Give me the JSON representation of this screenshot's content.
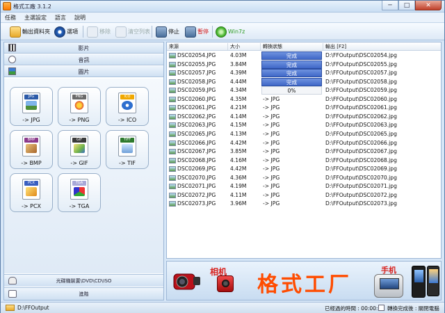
{
  "window": {
    "title": "格式工廠 3.1.2",
    "controls": {
      "minimize": "─",
      "maximize": "□",
      "close": "✕"
    }
  },
  "menu": [
    "任務",
    "主選設定",
    "語言",
    "說明"
  ],
  "toolbar": {
    "output_folder": "輸出資料夾",
    "options": "選項",
    "remove": "移除",
    "clear_list": "清空列表",
    "stop": "停止",
    "pause": "暫停",
    "win7z": "Win7z"
  },
  "left": {
    "categories": {
      "video": "影片",
      "audio": "音訊",
      "picture": "圖片"
    },
    "formats": [
      {
        "tag": "JPG",
        "label": "-> JPG",
        "tag_color": "#2b5aa8"
      },
      {
        "tag": "PNG",
        "label": "-> PNG",
        "tag_color": "#6a6a6a"
      },
      {
        "tag": "ICO",
        "label": "-> ICO",
        "tag_color": "#f0a800"
      },
      {
        "tag": "BMP",
        "label": "-> BMP",
        "tag_color": "#8b3a8b"
      },
      {
        "tag": "GIF",
        "label": "-> GIF",
        "tag_color": "#3a3a3a"
      },
      {
        "tag": "TIFF",
        "label": "-> TIF",
        "tag_color": "#2e7a2e"
      },
      {
        "tag": "PCX",
        "label": "-> PCX",
        "tag_color": "#3a5fc0"
      },
      {
        "tag": "TGA",
        "label": "-> TGA",
        "tag_color": "#a8a8d8"
      }
    ],
    "rom_device": "光碟機裝置\\DVD\\CD\\ISO",
    "advanced": "進階"
  },
  "list": {
    "headers": {
      "source": "來源",
      "size": "大小",
      "status": "轉換狀態",
      "output": "輸出 [F2]"
    },
    "rows": [
      {
        "source": "DSC02054.JPG",
        "size": "4.03M",
        "status": "完成",
        "state": "done",
        "output": "D:\\FFOutput\\DSC02054.jpg"
      },
      {
        "source": "DSC02055.JPG",
        "size": "3.84M",
        "status": "完成",
        "state": "done",
        "output": "D:\\FFOutput\\DSC02055.jpg"
      },
      {
        "source": "DSC02057.JPG",
        "size": "4.39M",
        "status": "完成",
        "state": "done",
        "output": "D:\\FFOutput\\DSC02057.jpg"
      },
      {
        "source": "DSC02058.JPG",
        "size": "4.44M",
        "status": "完成",
        "state": "done",
        "output": "D:\\FFOutput\\DSC02058.jpg"
      },
      {
        "source": "DSC02059.JPG",
        "size": "4.34M",
        "status": "0%",
        "state": "progress",
        "output": "D:\\FFOutput\\DSC02059.jpg"
      },
      {
        "source": "DSC02060.JPG",
        "size": "4.35M",
        "status": "-> JPG",
        "state": "queued",
        "output": "D:\\FFOutput\\DSC02060.jpg"
      },
      {
        "source": "DSC02061.JPG",
        "size": "4.21M",
        "status": "-> JPG",
        "state": "queued",
        "output": "D:\\FFOutput\\DSC02061.jpg"
      },
      {
        "source": "DSC02062.JPG",
        "size": "4.14M",
        "status": "-> JPG",
        "state": "queued",
        "output": "D:\\FFOutput\\DSC02062.jpg"
      },
      {
        "source": "DSC02063.JPG",
        "size": "4.15M",
        "status": "-> JPG",
        "state": "queued",
        "output": "D:\\FFOutput\\DSC02063.jpg"
      },
      {
        "source": "DSC02065.JPG",
        "size": "4.13M",
        "status": "-> JPG",
        "state": "queued",
        "output": "D:\\FFOutput\\DSC02065.jpg"
      },
      {
        "source": "DSC02066.JPG",
        "size": "4.42M",
        "status": "-> JPG",
        "state": "queued",
        "output": "D:\\FFOutput\\DSC02066.jpg"
      },
      {
        "source": "DSC02067.JPG",
        "size": "3.85M",
        "status": "-> JPG",
        "state": "queued",
        "output": "D:\\FFOutput\\DSC02067.jpg"
      },
      {
        "source": "DSC02068.JPG",
        "size": "4.16M",
        "status": "-> JPG",
        "state": "queued",
        "output": "D:\\FFOutput\\DSC02068.jpg"
      },
      {
        "source": "DSC02069.JPG",
        "size": "4.42M",
        "status": "-> JPG",
        "state": "queued",
        "output": "D:\\FFOutput\\DSC02069.jpg"
      },
      {
        "source": "DSC02070.JPG",
        "size": "4.36M",
        "status": "-> JPG",
        "state": "queued",
        "output": "D:\\FFOutput\\DSC02070.jpg"
      },
      {
        "source": "DSC02071.JPG",
        "size": "4.19M",
        "status": "-> JPG",
        "state": "queued",
        "output": "D:\\FFOutput\\DSC02071.jpg"
      },
      {
        "source": "DSC02072.JPG",
        "size": "4.11M",
        "status": "-> JPG",
        "state": "queued",
        "output": "D:\\FFOutput\\DSC02072.jpg"
      },
      {
        "source": "DSC02073.JPG",
        "size": "3.96M",
        "status": "-> JPG",
        "state": "queued",
        "output": "D:\\FFOutput\\DSC02073.jpg"
      }
    ]
  },
  "banner": {
    "camera_label": "相机",
    "title": "格式工厂",
    "phone_label": "手机"
  },
  "status": {
    "output_path": "D:\\FFOutput",
    "elapsed": "已經過的時間 : 00:00:03",
    "after_convert": "轉換完成後 : 關閉電腦"
  }
}
